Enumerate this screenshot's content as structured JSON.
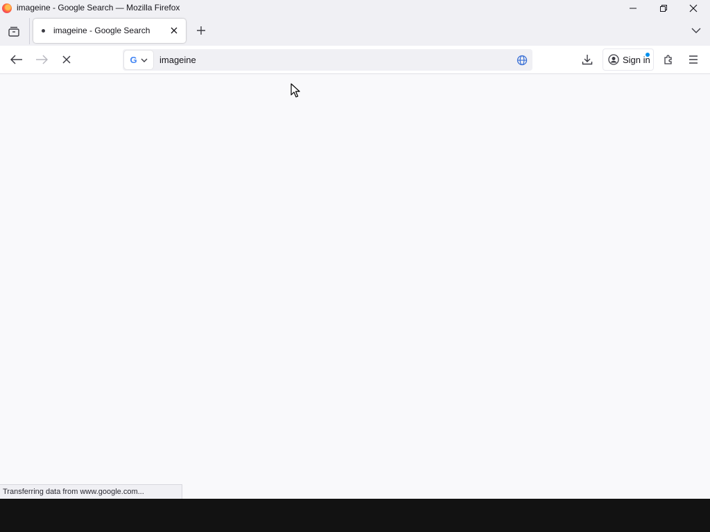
{
  "window": {
    "title": "imageine - Google Search — Mozilla Firefox"
  },
  "tab": {
    "title": "imageine - Google Search"
  },
  "urlbar": {
    "value": "imageine",
    "engine_icon": "google-icon"
  },
  "toolbar": {
    "signin_label": "Sign in"
  },
  "status": {
    "text": "Transferring data from www.google.com..."
  },
  "colors": {
    "accent": "#0090ed",
    "chrome": "#f0f0f4",
    "content_bg": "#f9f9fb",
    "taskbar": "#121212"
  }
}
